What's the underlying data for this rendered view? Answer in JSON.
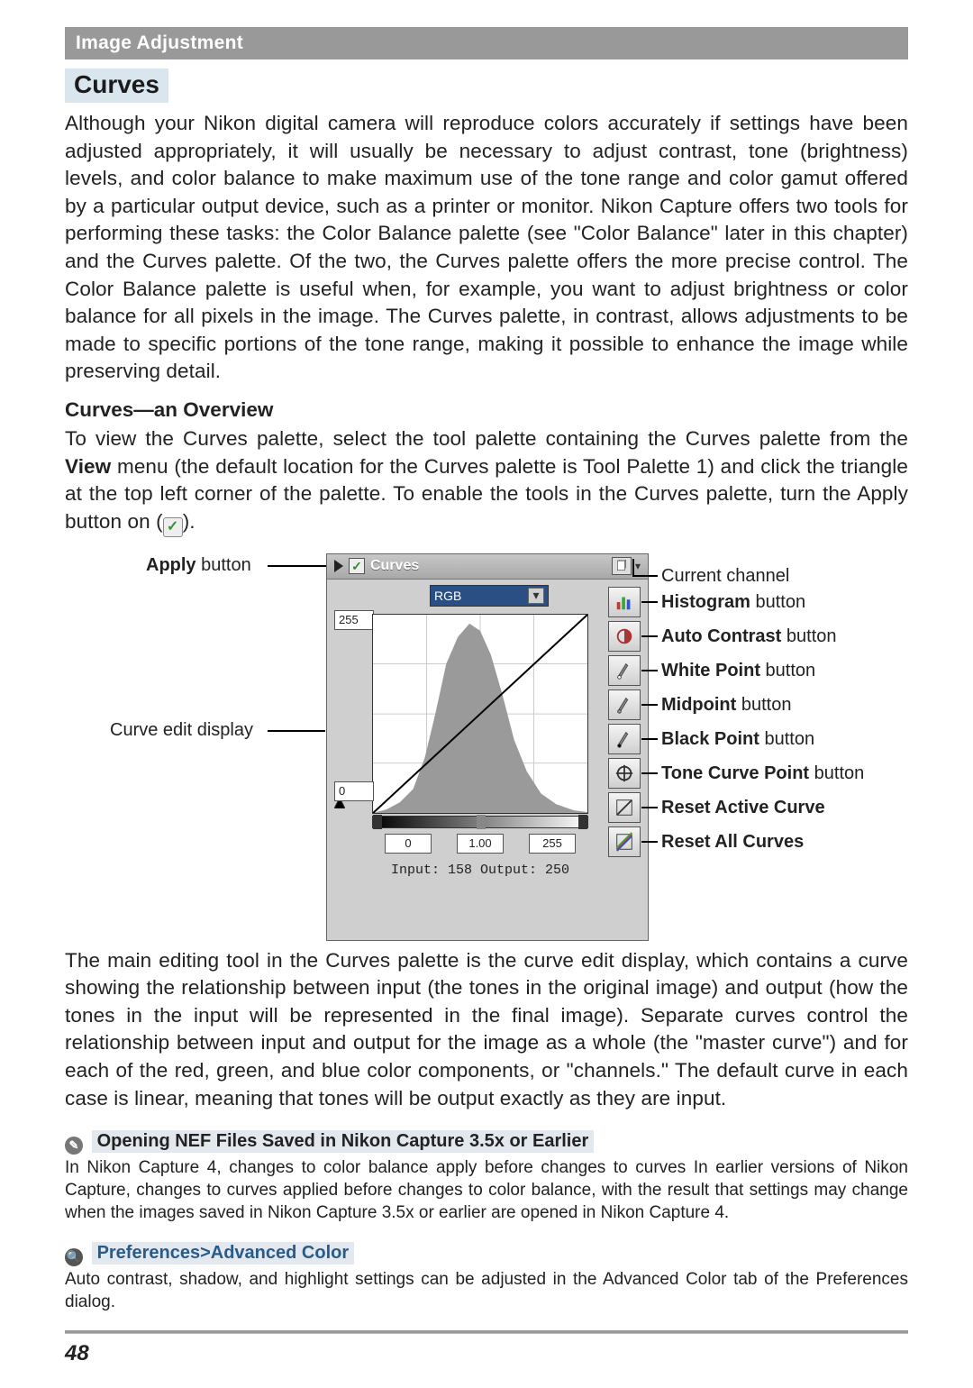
{
  "sectionBar": "Image Adjustment",
  "title": "Curves",
  "intro": "Although your Nikon digital camera will reproduce colors accurately if settings have been adjusted appropriately, it will usually be necessary to adjust contrast, tone (brightness) levels, and color balance to make maximum use of the tone range and color gamut offered by a particular output device, such as a printer or monitor.  Nikon Capture offers two tools for performing these tasks: the Color Balance palette (see \"Color Balance\" later in this chapter) and the Curves palette.  Of the two, the Curves palette offers the more precise control.  The Color Balance palette is useful when, for example, you want to adjust brightness or color balance for all pixels in the image.  The Curves palette, in contrast, allows adjustments to be made to specific portions of the tone range, making it possible to enhance the image while preserving detail.",
  "overviewHead": "Curves—an Overview",
  "overview_pre": "To view the Curves palette, select the tool palette containing the Curves palette from the ",
  "overview_view": "View",
  "overview_post": " menu (the default location for the Curves palette is Tool Palette 1) and click the triangle at the top left corner of the palette.  To enable the tools in the Curves palette, turn the Apply button on (",
  "overview_end": ").",
  "labels": {
    "apply": "Apply",
    "apply_suffix": " button",
    "curveEdit": "Curve edit display",
    "currentChannel": "Current channel",
    "histogram": "Histogram",
    "autoContrast": "Auto Contrast",
    "whitePoint": "White Point",
    "midpoint": "Midpoint",
    "blackPoint": "Black Point",
    "toneCurvePoint": "Tone Curve Point",
    "resetActive": "Reset Active Curve",
    "resetAll": "Reset All Curves",
    "button_suffix": " button"
  },
  "panel": {
    "title": "Curves",
    "channel": "RGB",
    "outTop": "255",
    "outBottom": "0",
    "inLeft": "0",
    "inMid": "1.00",
    "inRight": "255",
    "ioLine": "Input: 158  Output: 250"
  },
  "mainEditing": "The main editing tool in the Curves palette is the curve edit display, which contains a curve showing the relationship between input (the tones in the original image) and output (how the tones in the input will be represented in the final image).  Separate curves control the relationship between input and output for the image as a whole (the \"master curve\") and for each of the red, green, and blue color components, or \"channels.\" The default curve in each case is linear, meaning that tones will be output exactly as they are input.",
  "note1Head": "Opening NEF Files Saved in Nikon Capture 3.5x or Earlier",
  "note1": "In Nikon Capture 4, changes to color balance apply before changes to curves In earlier versions of Nikon Capture, changes to curves applied before changes to color balance, with the result that settings may change when the images saved in Nikon Capture 3.5x or earlier are opened in Nikon Capture 4.",
  "note2Head": "Preferences>Advanced Color",
  "note2": "Auto contrast, shadow, and highlight settings can be adjusted in the Advanced Color tab of the Preferences dialog.",
  "pageNumber": "48"
}
